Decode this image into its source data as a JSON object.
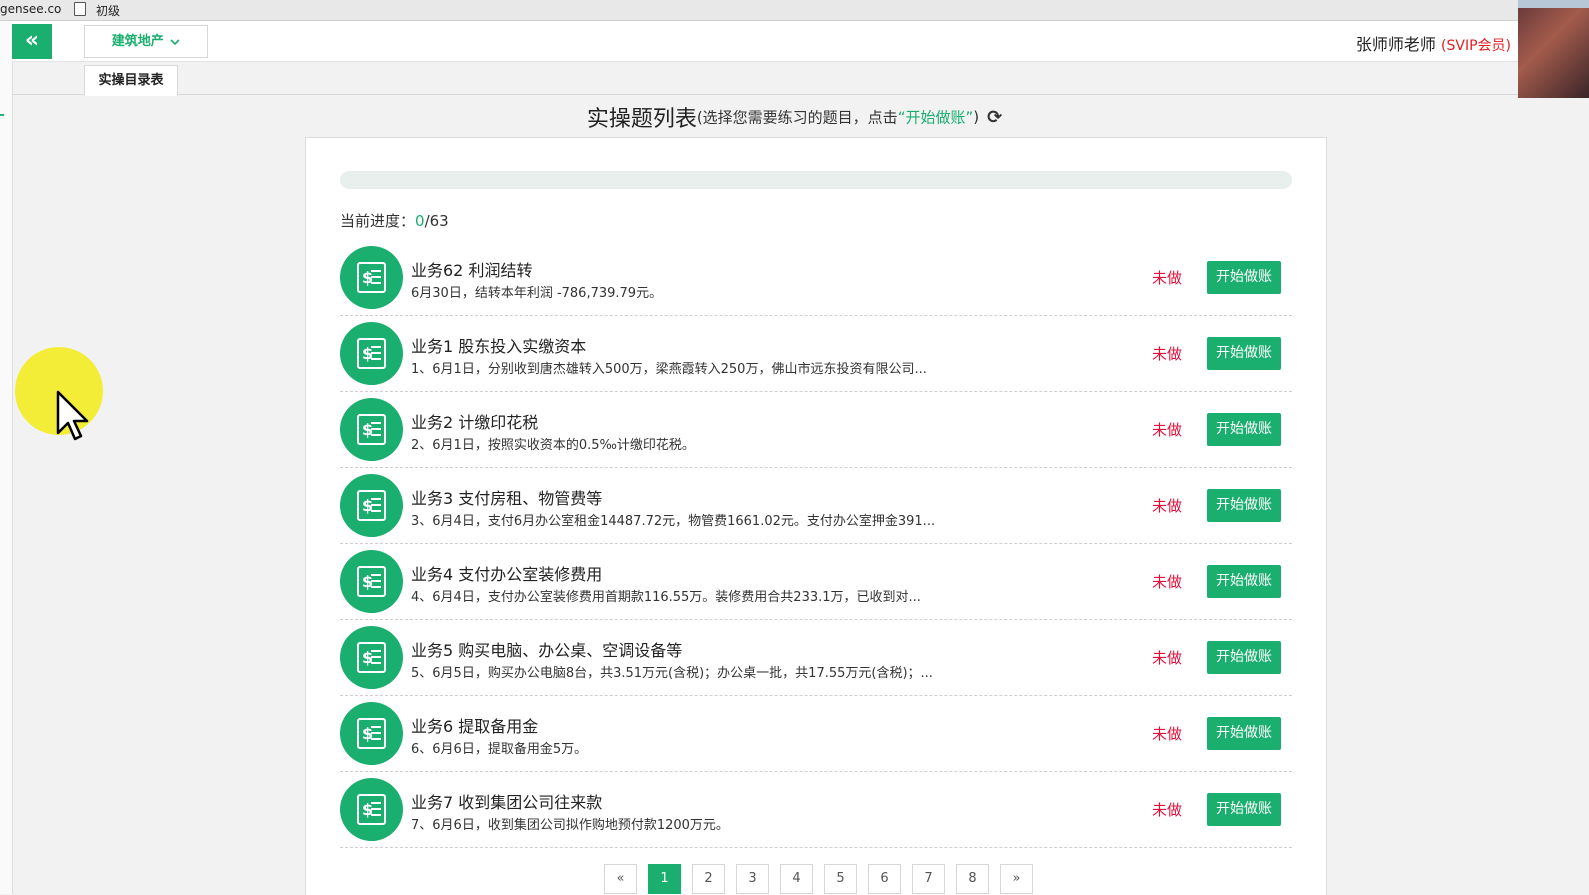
{
  "browser": {
    "url_fragment": "gensee.co",
    "tab_title": "初级"
  },
  "header": {
    "collapse_icon": "«",
    "industry_select": "建筑地产",
    "user_name": "张师师老师",
    "user_level": "(SVIP会员)"
  },
  "tabs": {
    "active": "实操目录表"
  },
  "list": {
    "title": "实操题列表",
    "hint_prefix": "(选择您需要练习的题目，点击",
    "hint_action": "“开始做账”",
    "hint_suffix": ")",
    "refresh_icon": "⟳",
    "progress_label": "当前进度：",
    "progress_done": "0",
    "progress_total": "/63",
    "progress_fraction": 0,
    "tasks": [
      {
        "title": "业务62 利润结转",
        "desc": "6月30日，结转本年利润 -786,739.79元。",
        "status": "未做",
        "action": "开始做账"
      },
      {
        "title": "业务1 股东投入实缴资本",
        "desc": "1、6月1日，分别收到唐杰雄转入500万，梁燕霞转入250万，佛山市远东投资有限公司...",
        "status": "未做",
        "action": "开始做账"
      },
      {
        "title": "业务2 计缴印花税",
        "desc": "2、6月1日，按照实收资本的0.5‰计缴印花税。",
        "status": "未做",
        "action": "开始做账"
      },
      {
        "title": "业务3 支付房租、物管费等",
        "desc": "3、6月4日，支付6月办公室租金14487.72元，物管费1661.02元。支付办公室押金391...",
        "status": "未做",
        "action": "开始做账"
      },
      {
        "title": "业务4 支付办公室装修费用",
        "desc": "4、6月4日，支付办公室装修费用首期款116.55万。装修费用合共233.1万，已收到对...",
        "status": "未做",
        "action": "开始做账"
      },
      {
        "title": "业务5 购买电脑、办公桌、空调设备等",
        "desc": "5、6月5日，购买办公电脑8台，共3.51万元(含税)；办公桌一批，共17.55万元(含税)；...",
        "status": "未做",
        "action": "开始做账"
      },
      {
        "title": "业务6 提取备用金",
        "desc": "6、6月6日，提取备用金5万。",
        "status": "未做",
        "action": "开始做账"
      },
      {
        "title": "业务7 收到集团公司往来款",
        "desc": "7、6月6日，收到集团公司拟作购地预付款1200万元。",
        "status": "未做",
        "action": "开始做账"
      }
    ]
  },
  "pagination": {
    "prev": "«",
    "pages": [
      "1",
      "2",
      "3",
      "4",
      "5",
      "6",
      "7",
      "8"
    ],
    "active": "1",
    "next": "»"
  },
  "colors": {
    "accent": "#1aae6f",
    "status_red": "#e0103c",
    "vip_red": "#e02020"
  }
}
